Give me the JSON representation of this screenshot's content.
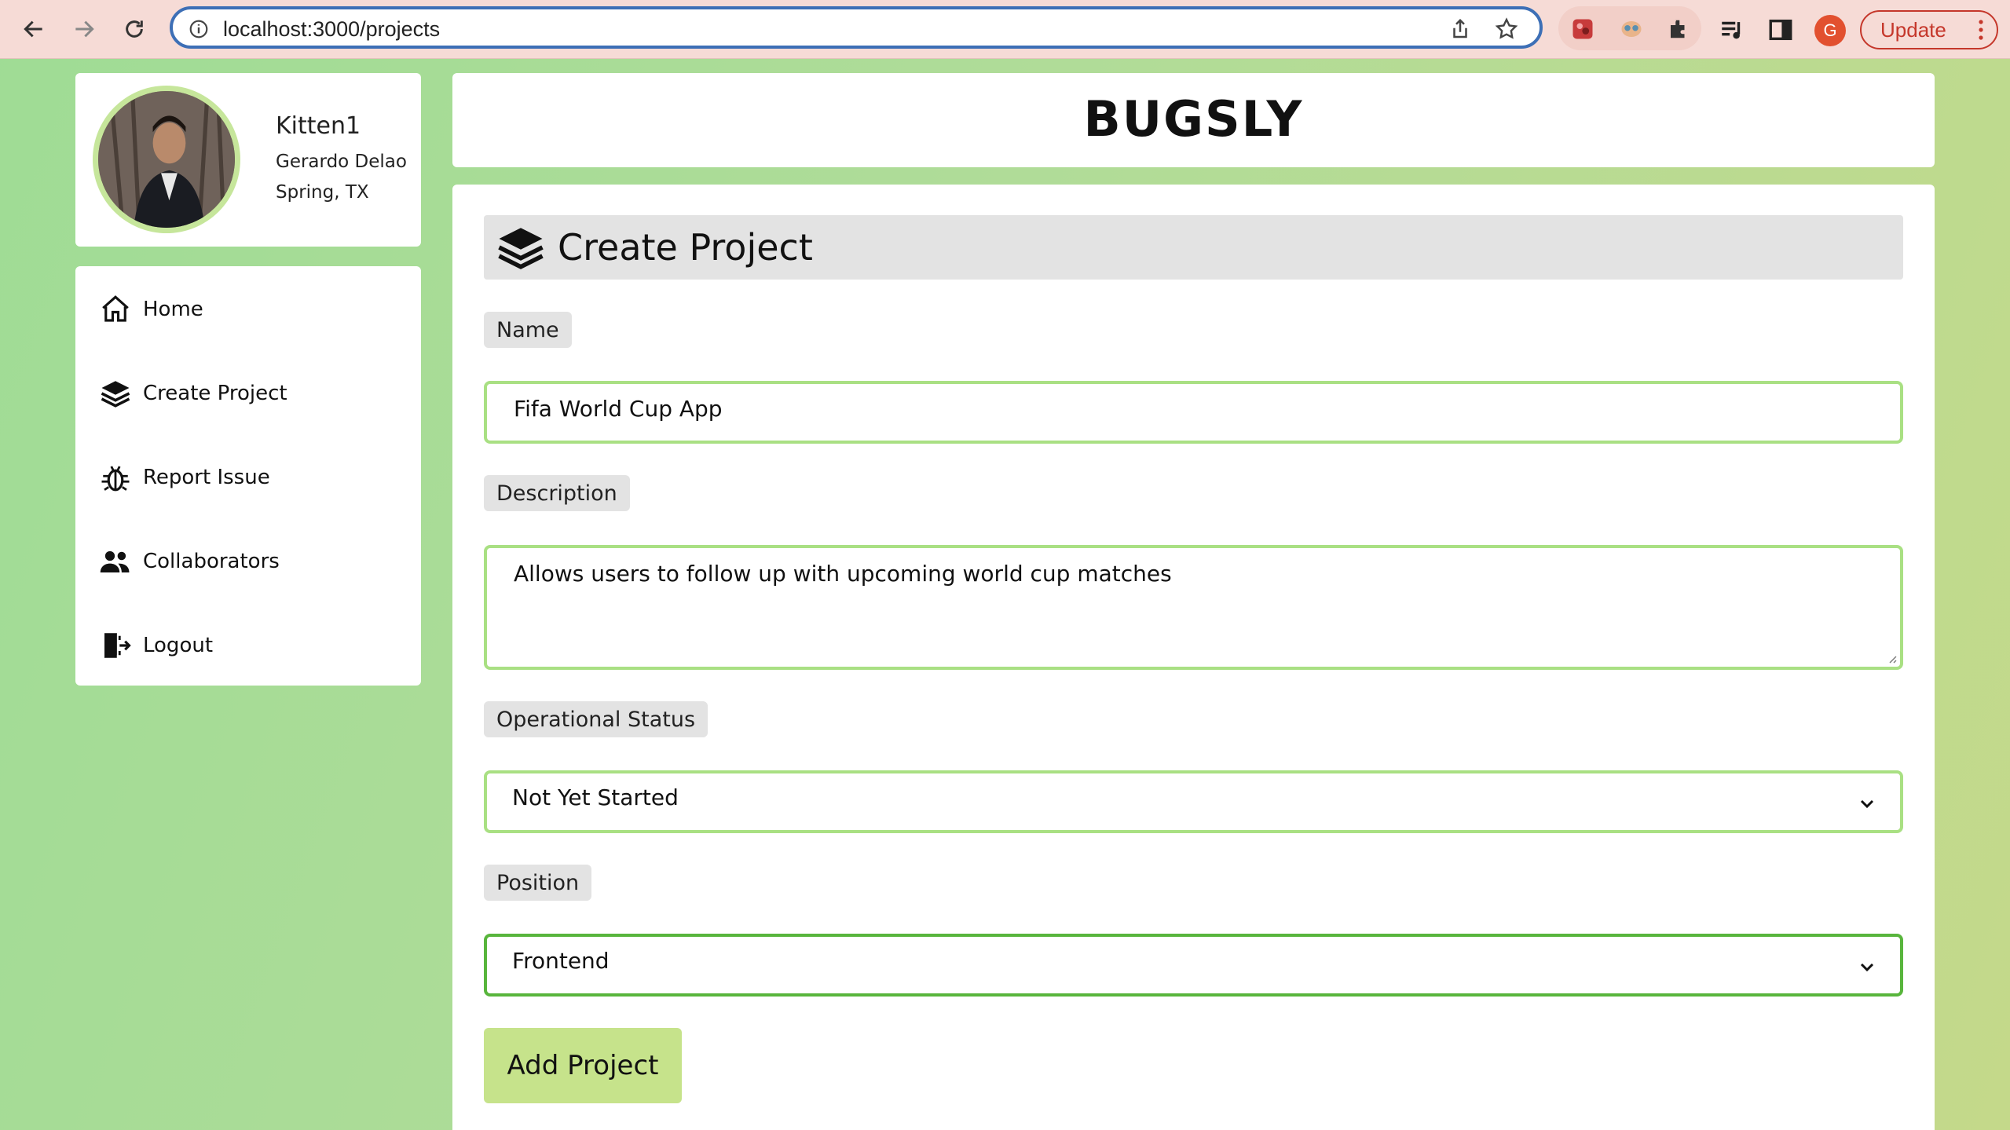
{
  "browser": {
    "url": "localhost:3000/projects",
    "profile_initial": "G",
    "update_label": "Update"
  },
  "profile": {
    "username": "Kitten1",
    "full_name": "Gerardo Delao",
    "location": "Spring, TX"
  },
  "sidebar": {
    "items": [
      {
        "label": "Home",
        "icon": "home-icon"
      },
      {
        "label": "Create Project",
        "icon": "layers-icon"
      },
      {
        "label": "Report Issue",
        "icon": "bug-icon"
      },
      {
        "label": "Collaborators",
        "icon": "users-icon"
      },
      {
        "label": "Logout",
        "icon": "logout-icon"
      }
    ]
  },
  "header": {
    "brand": "BUGSLY"
  },
  "form": {
    "title": "Create Project",
    "name_label": "Name",
    "name_value": "Fifa World Cup App",
    "description_label": "Description",
    "description_value": "Allows users to follow up with upcoming world cup matches",
    "status_label": "Operational Status",
    "status_value": "Not Yet Started",
    "position_label": "Position",
    "position_value": "Frontend",
    "submit_label": "Add Project"
  },
  "colors": {
    "field_border": "#a9e083",
    "field_border_focused": "#58b53c",
    "button_bg": "#c6e38b",
    "chip_bg": "#e3e3e3"
  }
}
